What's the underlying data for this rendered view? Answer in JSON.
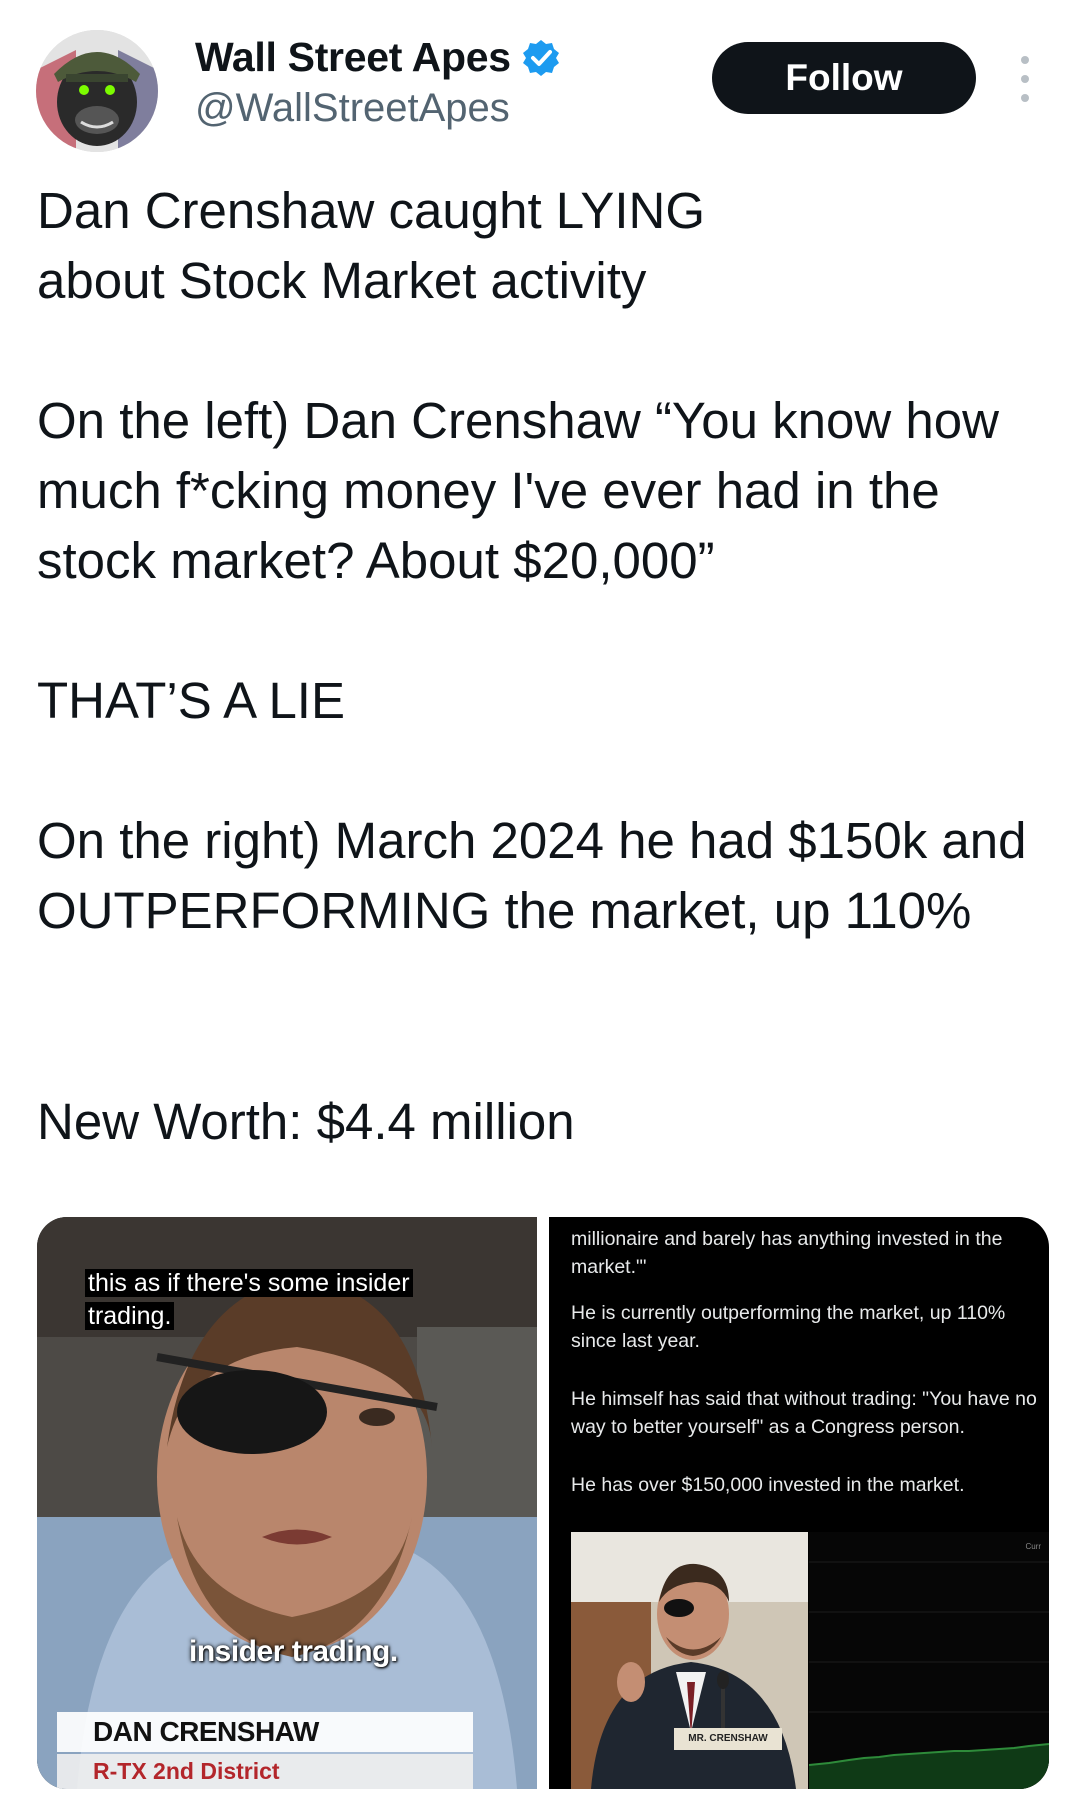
{
  "header": {
    "display_name": "Wall Street Apes",
    "handle": "@WallStreetApes",
    "follow_label": "Follow",
    "verified_icon": "verified-badge-icon",
    "more_icon": "more-options-icon"
  },
  "tweet": {
    "headline": "Dan Crenshaw caught LYING about Stock Market activity",
    "quote": "On the left) Dan Crenshaw “You know how much f*cking money I've ever had in the stock market? About $20,000”",
    "lie": "THAT’S A LIE",
    "right": "On the right) March 2024 he had $150k and OUTPERFORMING the market, up 110%",
    "worth": "New Worth: $4.4 million"
  },
  "media": {
    "left": {
      "caption_top_line1": "this as if there's some insider",
      "caption_top_line2": "trading.",
      "caption_bottom": "insider trading.",
      "lower_third_name": "DAN CRENSHAW",
      "lower_third_sub": "R-TX 2nd District"
    },
    "right": {
      "p1": "millionaire and barely has anything invested in the market.\"'",
      "p2": "He is currently outperforming the market, up 110% since last year.",
      "p3": "He himself has said that without trading: \"You have no way to better yourself\" as a Congress person.",
      "p4": "He has over $150,000 invested in the market.",
      "nameplate": "MR. CRENSHAW",
      "chart_corner": "Curr"
    }
  },
  "colors": {
    "follow_bg": "#0f1419",
    "verified": "#1d9bf0",
    "handle_gray": "#536471",
    "chart_line": "#2e8b3a"
  }
}
